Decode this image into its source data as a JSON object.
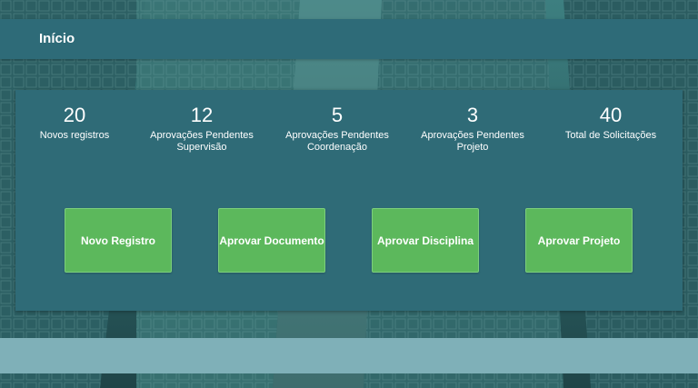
{
  "header": {
    "title": "Início"
  },
  "stats": [
    {
      "value": "20",
      "label": "Novos registros"
    },
    {
      "value": "12",
      "label": "Aprovações Pendentes\nSupervisão"
    },
    {
      "value": "5",
      "label": "Aprovações Pendentes\nCoordenação"
    },
    {
      "value": "3",
      "label": "Aprovações Pendentes\nProjeto"
    },
    {
      "value": "40",
      "label": "Total de Solicitações"
    }
  ],
  "actions": {
    "novo_registro": "Novo Registro",
    "aprovar_documento": "Aprovar Documento",
    "aprovar_disciplina": "Aprovar Disciplina",
    "aprovar_projeto": "Aprovar Projeto"
  },
  "colors": {
    "header": "#2e6b78",
    "panel": "#2f6b77",
    "button": "#5cb85c",
    "footer": "#7fb0b8"
  }
}
